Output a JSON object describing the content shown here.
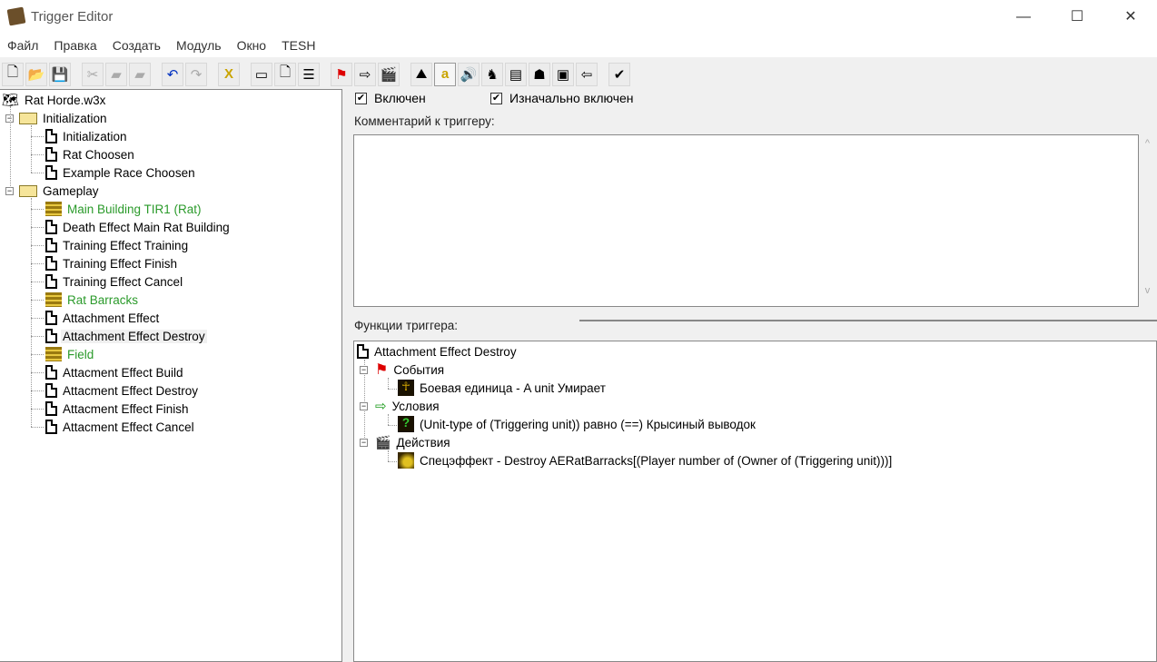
{
  "window": {
    "title": "Trigger Editor",
    "minimize": "—",
    "maximize": "☐",
    "close": "✕"
  },
  "menu": [
    "Файл",
    "Правка",
    "Создать",
    "Модуль",
    "Окно",
    "TESH"
  ],
  "toolbar": [
    {
      "name": "new-icon",
      "glyph": "🗋"
    },
    {
      "name": "open-icon",
      "glyph": "📂"
    },
    {
      "name": "save-icon",
      "glyph": "💾"
    },
    {
      "name": "cut-icon",
      "glyph": "✂",
      "disabled": true
    },
    {
      "name": "copy-icon",
      "glyph": "▰",
      "disabled": true
    },
    {
      "name": "paste-icon",
      "glyph": "▰",
      "disabled": true
    },
    {
      "name": "undo-icon",
      "glyph": "↶"
    },
    {
      "name": "redo-icon",
      "glyph": "↷",
      "disabled": true
    },
    {
      "name": "delete-icon",
      "glyph": "X"
    },
    {
      "name": "new-category-icon",
      "glyph": "▭"
    },
    {
      "name": "new-trigger-icon",
      "glyph": "🗋"
    },
    {
      "name": "new-comment-icon",
      "glyph": "☰"
    },
    {
      "name": "new-event-icon",
      "glyph": "⚑"
    },
    {
      "name": "new-condition-icon",
      "glyph": "⇨"
    },
    {
      "name": "new-action-icon",
      "glyph": "🎬"
    },
    {
      "name": "terrain-editor-icon",
      "glyph": "⛰"
    },
    {
      "name": "trigger-editor-icon",
      "glyph": "a",
      "pressed": true
    },
    {
      "name": "sound-editor-icon",
      "glyph": "🔊"
    },
    {
      "name": "object-editor-icon",
      "glyph": "♞"
    },
    {
      "name": "campaign-editor-icon",
      "glyph": "▤"
    },
    {
      "name": "ai-editor-icon",
      "glyph": "☗"
    },
    {
      "name": "import-manager-icon",
      "glyph": "▣"
    },
    {
      "name": "script-icon",
      "glyph": "⇦"
    },
    {
      "name": "test-map-icon",
      "glyph": "✔"
    }
  ],
  "tree": {
    "root": "Rat Horde.w3x",
    "categories": [
      {
        "label": "Initialization",
        "items": [
          {
            "label": "Initialization",
            "type": "doc"
          },
          {
            "label": "Rat Choosen",
            "type": "doc"
          },
          {
            "label": "Example Race Choosen",
            "type": "doc"
          }
        ]
      },
      {
        "label": "Gameplay",
        "items": [
          {
            "label": "Main Building TIR1 (Rat)",
            "type": "comment"
          },
          {
            "label": "Death Effect Main Rat Building",
            "type": "doc"
          },
          {
            "label": "Training Effect Training",
            "type": "doc"
          },
          {
            "label": "Training Effect Finish",
            "type": "doc"
          },
          {
            "label": "Training Effect Cancel",
            "type": "doc"
          },
          {
            "label": "Rat Barracks",
            "type": "comment"
          },
          {
            "label": "Attachment Effect",
            "type": "doc"
          },
          {
            "label": "Attachment Effect Destroy",
            "type": "doc",
            "selected": true
          },
          {
            "label": "Field",
            "type": "comment"
          },
          {
            "label": "Attacment Effect Build",
            "type": "doc"
          },
          {
            "label": "Attacment Effect Destroy",
            "type": "doc"
          },
          {
            "label": "Attacment Effect Finish",
            "type": "doc"
          },
          {
            "label": "Attacment Effect Cancel",
            "type": "doc"
          }
        ]
      }
    ]
  },
  "props": {
    "enabled": "Включен",
    "initially_on": "Изначально включен",
    "comment_label": "Комментарий к триггеру:",
    "functions_label": "Функции триггера:"
  },
  "functions": {
    "title": "Attachment Effect Destroy",
    "events": "События",
    "event1": "Боевая единица - A unit Умирает",
    "conditions": "Условия",
    "condition1": "(Unit-type of (Triggering unit)) равно (==) Крысиный выводок",
    "actions": "Действия",
    "action1": "Спецэффект - Destroy AERatBarracks[(Player number of (Owner of (Triggering unit)))]"
  }
}
